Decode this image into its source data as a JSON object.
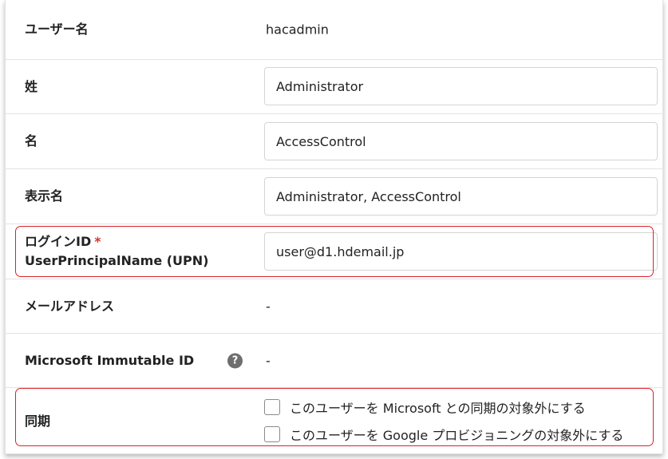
{
  "fields": {
    "username": {
      "label": "ユーザー名",
      "value": "hacadmin"
    },
    "last_name": {
      "label": "姓",
      "value": "Administrator"
    },
    "first_name": {
      "label": "名",
      "value": "AccessControl"
    },
    "display_name": {
      "label": "表示名",
      "value": "Administrator, AccessControl"
    },
    "login_id": {
      "label": "ログインID",
      "required_mark": "*",
      "sublabel": "UserPrincipalName (UPN)",
      "value": "user@d1.hdemail.jp"
    },
    "email": {
      "label": "メールアドレス",
      "value": "-"
    },
    "immutable_id": {
      "label": "Microsoft Immutable ID",
      "help_icon": "?",
      "value": "-"
    },
    "sync": {
      "label": "同期",
      "options": [
        {
          "label": "このユーザーを Microsoft との同期の対象外にする",
          "checked": false
        },
        {
          "label": "このユーザーを Google プロビジョニングの対象外にする",
          "checked": false
        }
      ]
    }
  },
  "colors": {
    "highlight": "#d6232c",
    "required": "#d9342b",
    "help_icon_bg": "#6e6e6e"
  }
}
